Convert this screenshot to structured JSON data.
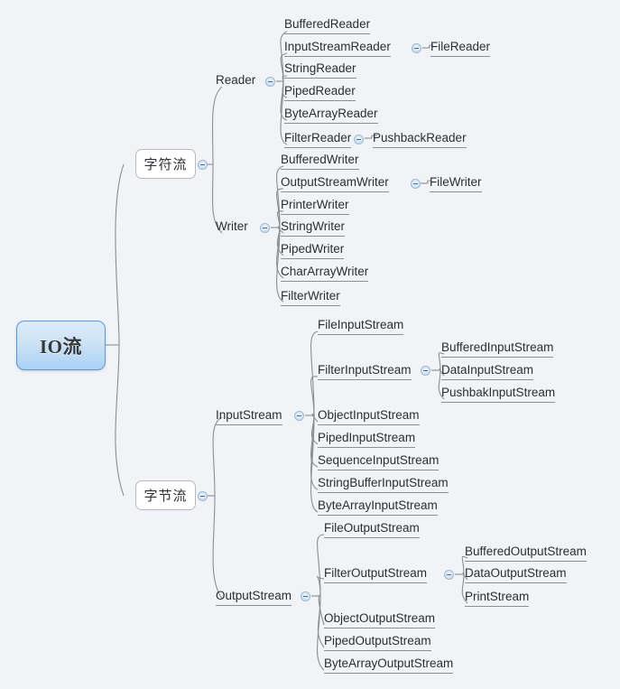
{
  "diagram": {
    "type": "mind-map",
    "title": "IO流",
    "background_color": "#f2f3f7",
    "root": {
      "label": "IO流",
      "accent_color": "#5b9bd5",
      "fill_from": "#dbeaf8",
      "fill_to": "#a9d2f3"
    },
    "toggle_icon_name": "collapse-minus-icon",
    "branches": [
      {
        "label": "字符流",
        "children": [
          {
            "label": "Reader",
            "children": [
              {
                "label": "BufferedReader"
              },
              {
                "label": "InputStreamReader",
                "children": [
                  {
                    "label": "FileReader"
                  }
                ]
              },
              {
                "label": "StringReader"
              },
              {
                "label": "PipedReader"
              },
              {
                "label": "ByteArrayReader"
              },
              {
                "label": "FilterReader",
                "children": [
                  {
                    "label": "PushbackReader"
                  }
                ]
              }
            ]
          },
          {
            "label": "Writer",
            "children": [
              {
                "label": "BufferedWriter"
              },
              {
                "label": "OutputStreamWriter",
                "children": [
                  {
                    "label": "FileWriter"
                  }
                ]
              },
              {
                "label": "PrinterWriter"
              },
              {
                "label": "StringWriter"
              },
              {
                "label": "PipedWriter"
              },
              {
                "label": "CharArrayWriter"
              },
              {
                "label": "FilterWriter"
              }
            ]
          }
        ]
      },
      {
        "label": "字节流",
        "children": [
          {
            "label": "InputStream",
            "children": [
              {
                "label": "FileInputStream"
              },
              {
                "label": "FilterInputStream",
                "children": [
                  {
                    "label": "BufferedInputStream"
                  },
                  {
                    "label": "DataInputStream"
                  },
                  {
                    "label": "PushbakInputStream"
                  }
                ]
              },
              {
                "label": "ObjectInputStream"
              },
              {
                "label": "PipedInputStream"
              },
              {
                "label": "SequenceInputStream"
              },
              {
                "label": "StringBufferInputStream"
              },
              {
                "label": "ByteArrayInputStream"
              }
            ]
          },
          {
            "label": "OutputStream",
            "children": [
              {
                "label": "FileOutputStream"
              },
              {
                "label": "FilterOutputStream",
                "children": [
                  {
                    "label": "BufferedOutputStream"
                  },
                  {
                    "label": "DataOutputStream"
                  },
                  {
                    "label": "PrintStream"
                  }
                ]
              },
              {
                "label": "ObjectOutputStream"
              },
              {
                "label": "PipedOutputStream"
              },
              {
                "label": "ByteArrayOutputStream"
              }
            ]
          }
        ]
      }
    ]
  },
  "labels": {
    "root": "IO流",
    "char_stream": "字符流",
    "byte_stream": "字节流",
    "reader": "Reader",
    "writer": "Writer",
    "input_stream": "InputStream",
    "output_stream": "OutputStream",
    "buffered_reader": "BufferedReader",
    "input_stream_reader": "InputStreamReader",
    "file_reader": "FileReader",
    "string_reader": "StringReader",
    "piped_reader": "PipedReader",
    "byte_array_reader": "ByteArrayReader",
    "filter_reader": "FilterReader",
    "pushback_reader": "PushbackReader",
    "buffered_writer": "BufferedWriter",
    "output_stream_writer": "OutputStreamWriter",
    "file_writer": "FileWriter",
    "printer_writer": "PrinterWriter",
    "string_writer": "StringWriter",
    "piped_writer": "PipedWriter",
    "char_array_writer": "CharArrayWriter",
    "filter_writer": "FilterWriter",
    "file_input_stream": "FileInputStream",
    "filter_input_stream": "FilterInputStream",
    "buffered_input_stream": "BufferedInputStream",
    "data_input_stream": "DataInputStream",
    "pushbak_input_stream": "PushbakInputStream",
    "object_input_stream": "ObjectInputStream",
    "piped_input_stream": "PipedInputStream",
    "sequence_input_stream": "SequenceInputStream",
    "string_buffer_input_stream": "StringBufferInputStream",
    "byte_array_input_stream": "ByteArrayInputStream",
    "file_output_stream": "FileOutputStream",
    "filter_output_stream": "FilterOutputStream",
    "buffered_output_stream": "BufferedOutputStream",
    "data_output_stream": "DataOutputStream",
    "print_stream": "PrintStream",
    "object_output_stream": "ObjectOutputStream",
    "piped_output_stream": "PipedOutputStream",
    "byte_array_output_stream": "ByteArrayOutputStream"
  }
}
